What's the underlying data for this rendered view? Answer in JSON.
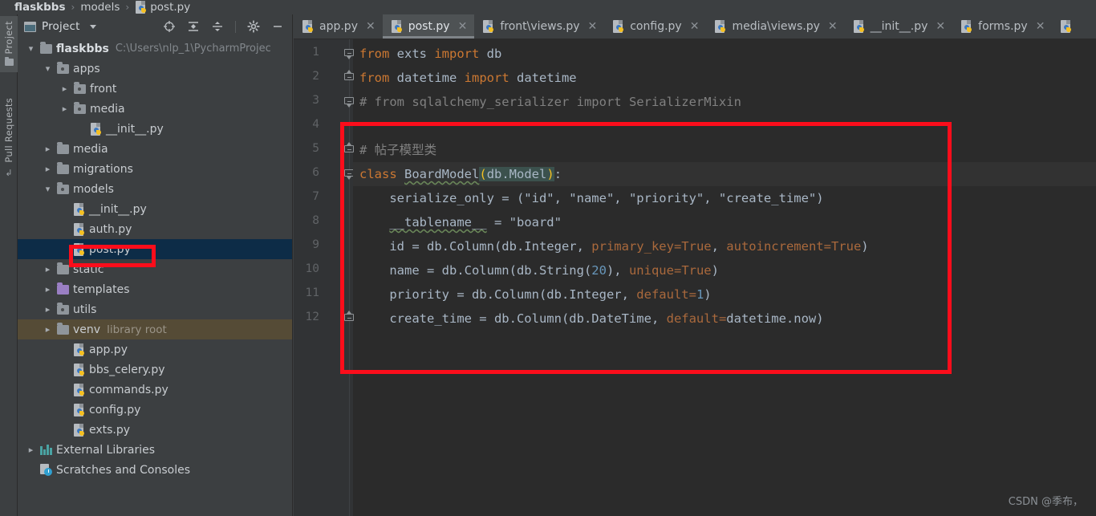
{
  "breadcrumb": {
    "root": "flaskbbs",
    "sep": "›",
    "folder": "models",
    "file": "post.py"
  },
  "toolstrip": {
    "project_label": "Project",
    "pull_requests_label": "Pull Requests"
  },
  "project_panel": {
    "title": "Project",
    "icons": [
      "locate-target-icon",
      "expand-all-icon",
      "collapse-all-icon",
      "settings-gear-icon",
      "minimize-icon"
    ]
  },
  "tree": [
    {
      "id": "flaskbbs",
      "label": "flaskbbs",
      "path": "C:\\Users\\nlp_1\\PycharmProjec",
      "indent": 0,
      "arrow": "down",
      "icon": "folder",
      "bold": true
    },
    {
      "id": "apps",
      "label": "apps",
      "indent": 1,
      "arrow": "down",
      "icon": "folder-dot"
    },
    {
      "id": "front",
      "label": "front",
      "indent": 2,
      "arrow": "right",
      "icon": "folder-dot"
    },
    {
      "id": "media-apps",
      "label": "media",
      "indent": 2,
      "arrow": "right",
      "icon": "folder-dot"
    },
    {
      "id": "init-apps",
      "label": "__init__.py",
      "indent": 3,
      "arrow": "none",
      "icon": "python-file"
    },
    {
      "id": "media",
      "label": "media",
      "indent": 1,
      "arrow": "right",
      "icon": "folder"
    },
    {
      "id": "migrations",
      "label": "migrations",
      "indent": 1,
      "arrow": "right",
      "icon": "folder"
    },
    {
      "id": "models",
      "label": "models",
      "indent": 1,
      "arrow": "down",
      "icon": "folder-dot"
    },
    {
      "id": "init-models",
      "label": "__init__.py",
      "indent": 2,
      "arrow": "none",
      "icon": "python-file"
    },
    {
      "id": "auth",
      "label": "auth.py",
      "indent": 2,
      "arrow": "none",
      "icon": "python-file"
    },
    {
      "id": "post",
      "label": "post.py",
      "indent": 2,
      "arrow": "none",
      "icon": "python-file",
      "selected": true
    },
    {
      "id": "static",
      "label": "static",
      "indent": 1,
      "arrow": "right",
      "icon": "folder"
    },
    {
      "id": "templates",
      "label": "templates",
      "indent": 1,
      "arrow": "right",
      "icon": "folder-purple"
    },
    {
      "id": "utils",
      "label": "utils",
      "indent": 1,
      "arrow": "right",
      "icon": "folder-dot"
    },
    {
      "id": "venv",
      "label": "venv",
      "sub": "library root",
      "indent": 1,
      "arrow": "right",
      "icon": "folder",
      "libroot": true
    },
    {
      "id": "app",
      "label": "app.py",
      "indent": 2,
      "arrow": "none",
      "icon": "python-file"
    },
    {
      "id": "bbs-celery",
      "label": "bbs_celery.py",
      "indent": 2,
      "arrow": "none",
      "icon": "python-file"
    },
    {
      "id": "commands",
      "label": "commands.py",
      "indent": 2,
      "arrow": "none",
      "icon": "python-file"
    },
    {
      "id": "config",
      "label": "config.py",
      "indent": 2,
      "arrow": "none",
      "icon": "python-file"
    },
    {
      "id": "exts",
      "label": "exts.py",
      "indent": 2,
      "arrow": "none",
      "icon": "python-file"
    },
    {
      "id": "external-libs",
      "label": "External Libraries",
      "indent": 0,
      "arrow": "right",
      "icon": "library"
    },
    {
      "id": "scratches",
      "label": "Scratches and Consoles",
      "indent": 0,
      "arrow": "none",
      "icon": "scratch"
    }
  ],
  "editor_tabs": [
    {
      "label": "app.py",
      "active": false,
      "closeable": true
    },
    {
      "label": "post.py",
      "active": true,
      "closeable": true
    },
    {
      "label": "front\\views.py",
      "active": false,
      "closeable": true
    },
    {
      "label": "config.py",
      "active": false,
      "closeable": true
    },
    {
      "label": "media\\views.py",
      "active": false,
      "closeable": true
    },
    {
      "label": "__init__.py",
      "active": false,
      "closeable": true
    },
    {
      "label": "forms.py",
      "active": false,
      "closeable": true
    },
    {
      "label": "",
      "active": false,
      "closeable": false
    }
  ],
  "gutter": {
    "line_numbers": [
      "1",
      "2",
      "3",
      "4",
      "5",
      "6",
      "7",
      "8",
      "9",
      "10",
      "11",
      "12"
    ]
  },
  "code": {
    "highlighted_line": 6,
    "lines": [
      {
        "n": 1,
        "text": "from exts import db"
      },
      {
        "n": 2,
        "text": "from datetime import datetime"
      },
      {
        "n": 3,
        "text": "# from sqlalchemy_serializer import SerializerMixin"
      },
      {
        "n": 4,
        "text": ""
      },
      {
        "n": 5,
        "text": "# 帖子模型类"
      },
      {
        "n": 6,
        "text": "class BoardModel(db.Model):"
      },
      {
        "n": 7,
        "text": "    serialize_only = (\"id\", \"name\", \"priority\", \"create_time\")"
      },
      {
        "n": 8,
        "text": "    __tablename__ = \"board\""
      },
      {
        "n": 9,
        "text": "    id = db.Column(db.Integer, primary_key=True, autoincrement=True)"
      },
      {
        "n": 10,
        "text": "    name = db.Column(db.String(20), unique=True)"
      },
      {
        "n": 11,
        "text": "    priority = db.Column(db.Integer, default=1)"
      },
      {
        "n": 12,
        "text": "    create_time = db.Column(db.DateTime, default=datetime.now)"
      }
    ]
  },
  "annotations": [
    {
      "name": "code-block-highlight",
      "color": "#fc0d1b"
    },
    {
      "name": "post-py-file-highlight",
      "color": "#fc0d1b"
    }
  ],
  "watermark": "CSDN @季布，",
  "colors": {
    "editor_bg": "#2b2b2b",
    "panel_bg": "#3c3f41",
    "gutter_bg": "#313335",
    "selection_bg": "#0d2c47",
    "libroot_bg": "#554b36",
    "keyword": "#cc7832",
    "string": "#6a8759",
    "number": "#6897bb",
    "comment": "#808080",
    "default_text": "#a9b7c6",
    "annotation_red": "#fc0d1b"
  }
}
